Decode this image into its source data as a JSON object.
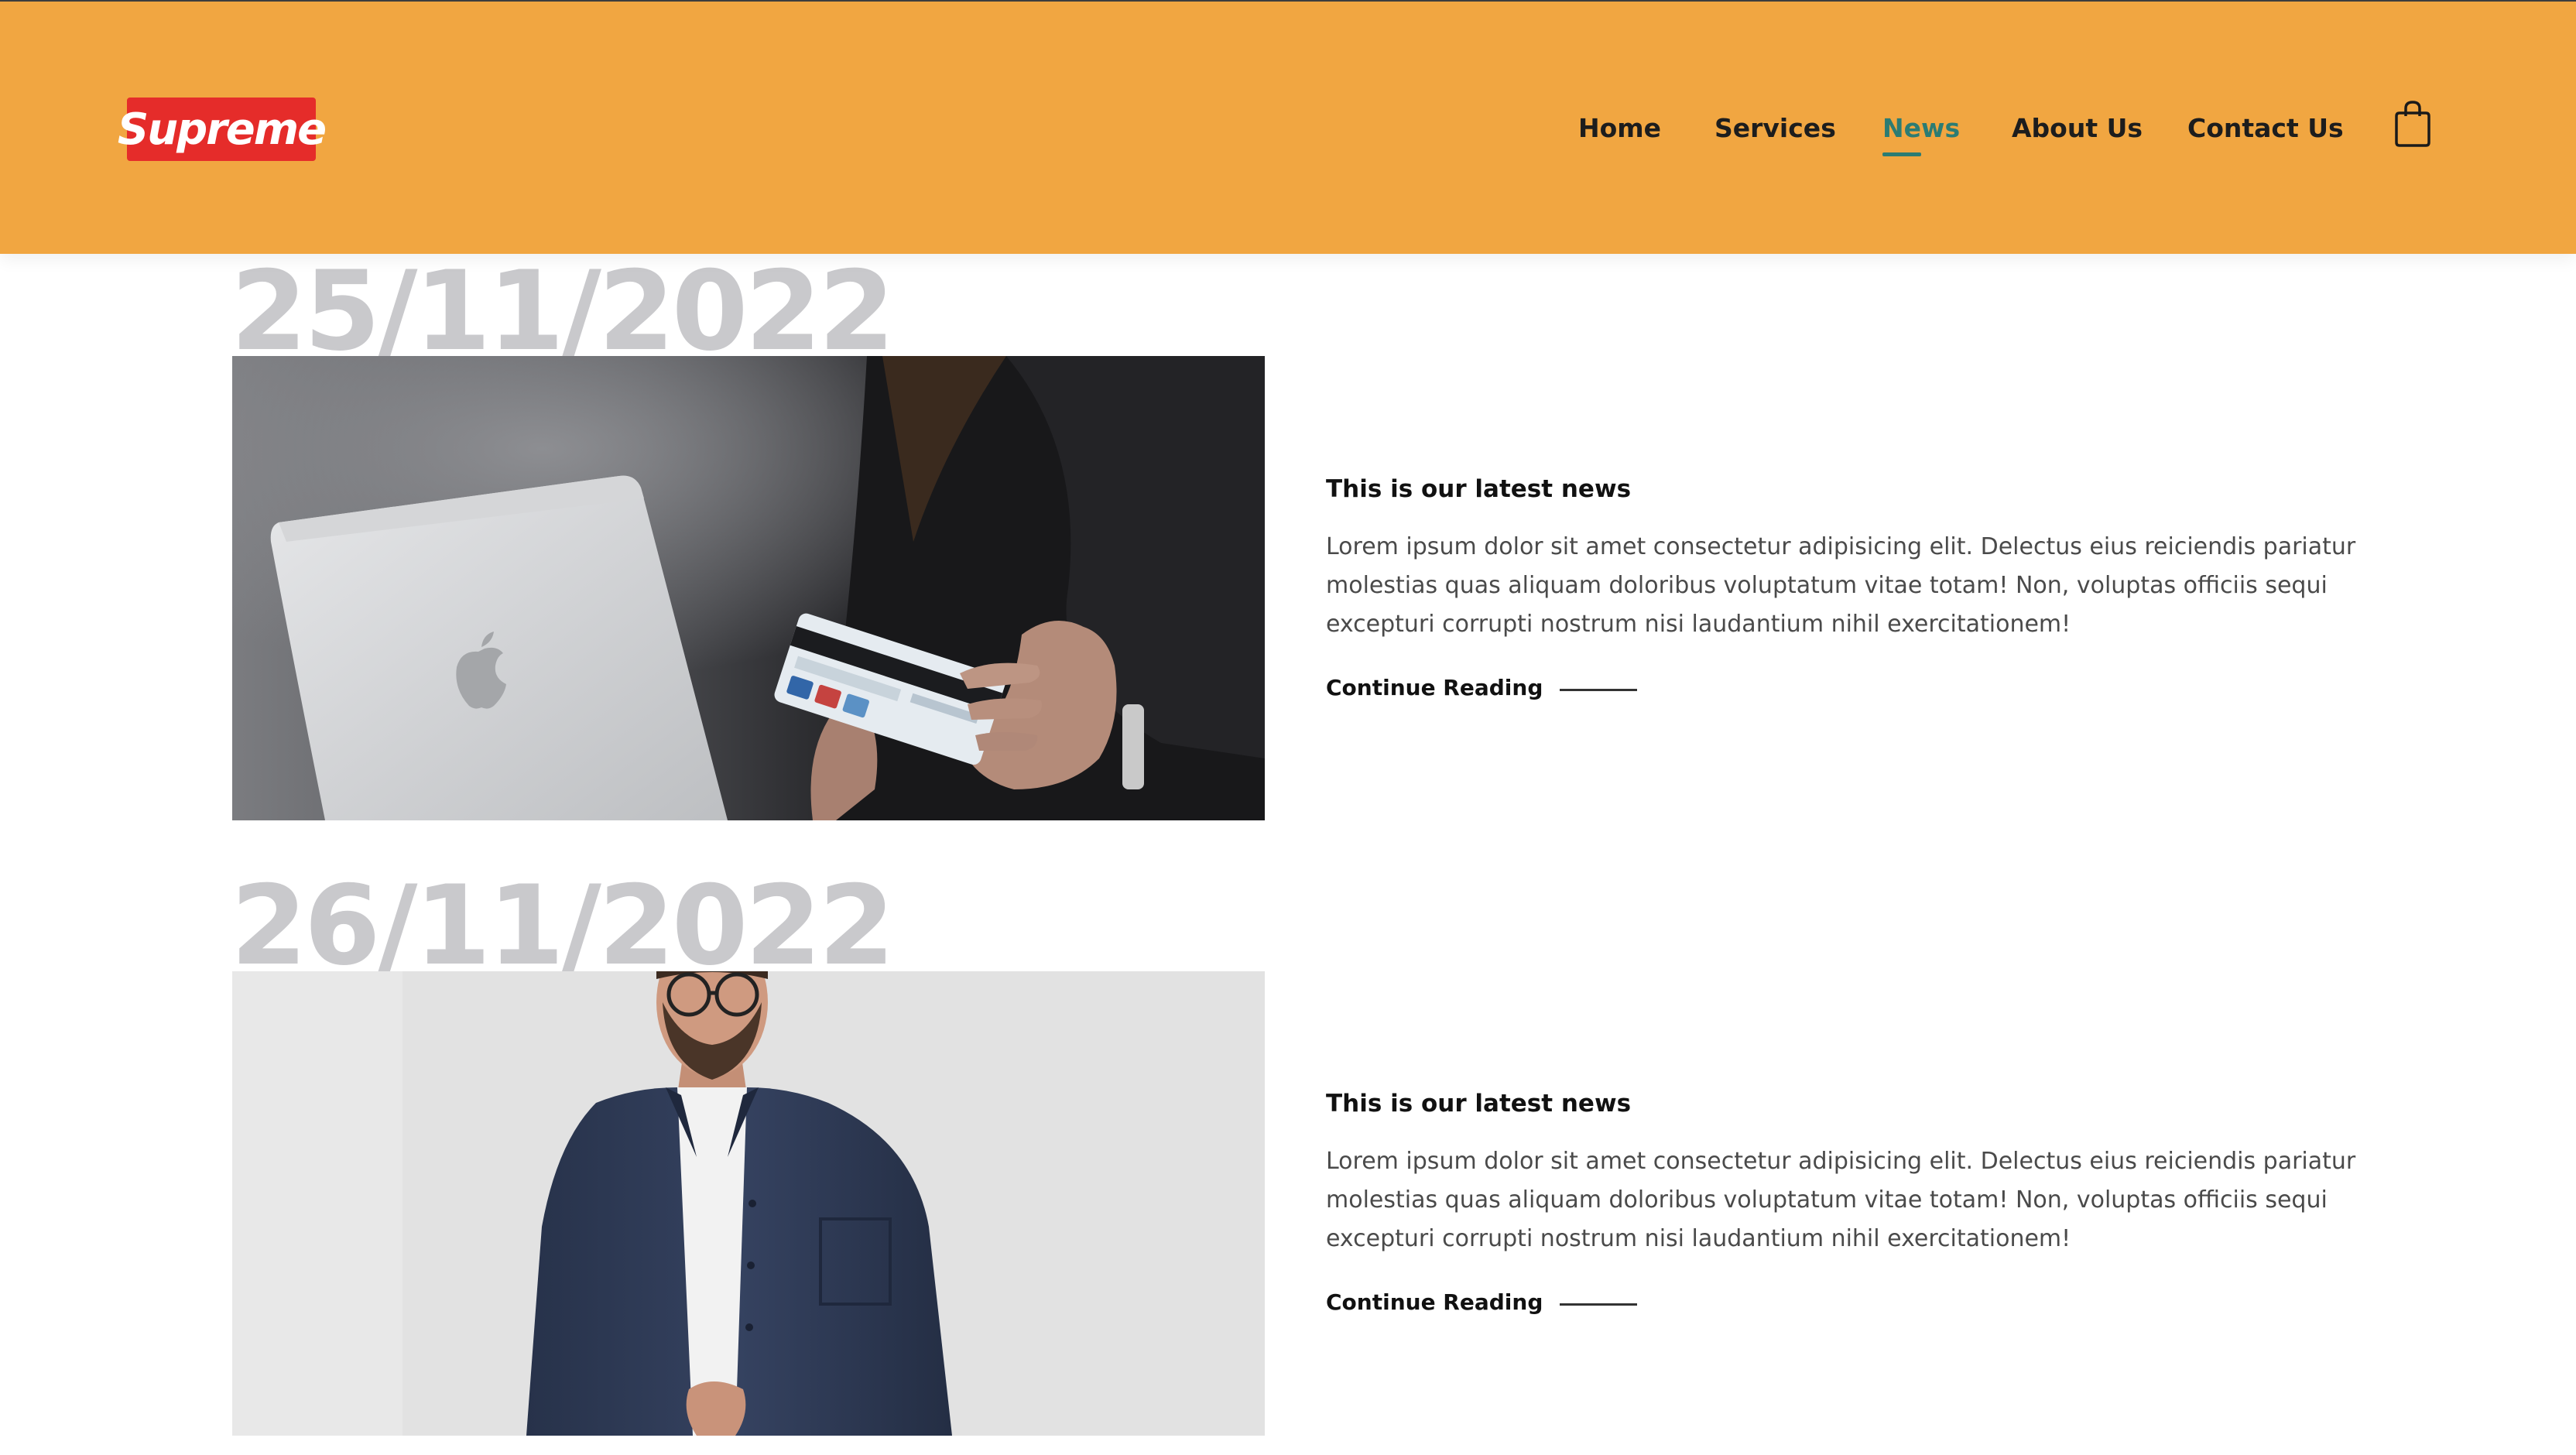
{
  "header": {
    "logo_text": "Supreme",
    "nav": [
      {
        "label": "Home",
        "active": false
      },
      {
        "label": "Services",
        "active": false
      },
      {
        "label": "News",
        "active": true
      },
      {
        "label": "About Us",
        "active": false
      },
      {
        "label": "Contact Us",
        "active": false
      }
    ],
    "cart_icon": "shopping-bag-icon"
  },
  "colors": {
    "header_bg": "#f1a641",
    "logo_bg": "#e52c2a",
    "active_nav": "#2c7c73",
    "date_text": "#c9c9cc"
  },
  "posts": [
    {
      "date": "25/11/2022",
      "image": "laptop-and-credit-card-photo",
      "title": "This is our latest news",
      "body": "Lorem ipsum dolor sit amet consectetur adipisicing elit. Delectus eius reiciendis pariatur molestias quas aliquam doloribus voluptatum vitae totam! Non, voluptas officiis sequi excepturi corrupti nostrum nisi laudantium nihil exercitationem!",
      "cta": "Continue Reading"
    },
    {
      "date": "26/11/2022",
      "image": "man-with-glasses-photo",
      "title": "This is our latest news",
      "body": "Lorem ipsum dolor sit amet consectetur adipisicing elit. Delectus eius reiciendis pariatur molestias quas aliquam doloribus voluptatum vitae totam! Non, voluptas officiis sequi excepturi corrupti nostrum nisi laudantium nihil exercitationem!",
      "cta": "Continue Reading"
    }
  ]
}
